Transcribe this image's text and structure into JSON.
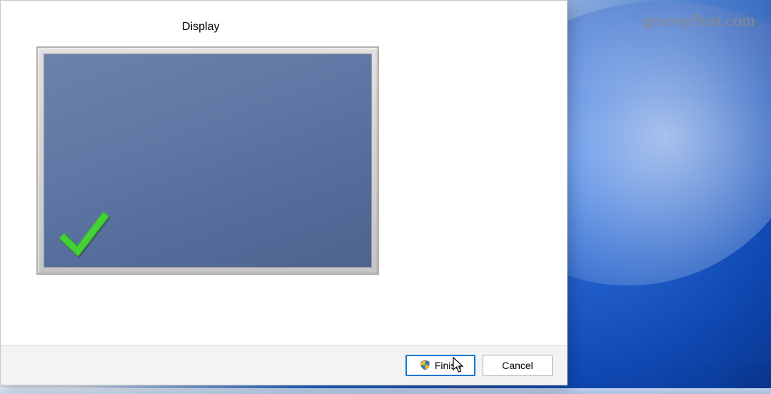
{
  "watermark": "groovyPost.com",
  "dialog": {
    "preview_label": "Display",
    "buttons": {
      "finish": "Finish",
      "cancel": "Cancel"
    }
  },
  "icons": {
    "shield": "uac-shield-icon",
    "check": "checkmark-icon",
    "cursor": "mouse-cursor"
  },
  "colors": {
    "accent": "#0078d4",
    "check_green": "#3fbf2f",
    "screen_blue": "#5f77a4"
  }
}
